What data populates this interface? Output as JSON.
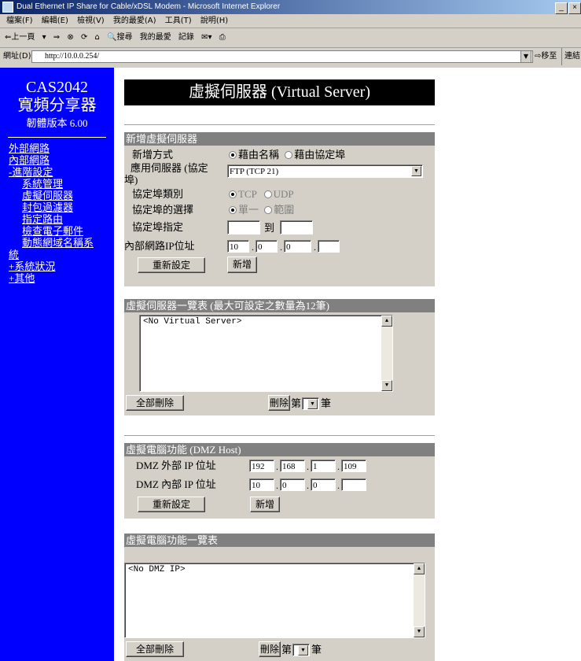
{
  "window": {
    "title": "Dual Ethernet IP Share for Cable/xDSL Modem - Microsoft Internet Explorer",
    "minimize": "_",
    "close": "×"
  },
  "menubar": [
    "檔案(F)",
    "編輯(E)",
    "檢視(V)",
    "我的最愛(A)",
    "工具(T)",
    "說明(H)"
  ],
  "toolbar": {
    "back": "⇐上一頁",
    "back_drop": "▾",
    "forward": "⇒",
    "stop": "⊗",
    "refresh": "⟳",
    "home": "⌂",
    "search": "🔍搜尋",
    "favorites": "我的最愛",
    "history": "記錄",
    "mail": "✉▾",
    "print": "⎙"
  },
  "address": {
    "label": "網址(D)",
    "url": "http://10.0.0.254/",
    "go": "⇨移至",
    "links": "連結"
  },
  "sidebar": {
    "logo_line1": "CAS2042",
    "logo_line2": "寬頻分享器",
    "firmware": "韌體版本 6.00",
    "items": [
      {
        "label": "外部網路"
      },
      {
        "label": "內部網路"
      },
      {
        "label": "-進階設定"
      },
      {
        "label": "系統管理"
      },
      {
        "label": "虛擬伺服器"
      },
      {
        "label": "封包過濾器"
      },
      {
        "label": "指定路由"
      },
      {
        "label": "檢查電子郵件"
      },
      {
        "label": "動態網域名稱系"
      },
      {
        "label": "統"
      },
      {
        "label": "+系統狀況"
      },
      {
        "label": "+其他"
      }
    ]
  },
  "page_title": "虛擬伺服器 (Virtual Server)",
  "add_vs": {
    "header": "新增虛擬伺服器",
    "method_label": "新增方式",
    "method_opt1": "藉由名稱",
    "method_opt2": "藉由協定埠",
    "app_label_1": "應用伺服器 (協定",
    "app_label_2": "埠)",
    "app_value": "FTP (TCP 21)",
    "proto_label": "協定埠類別",
    "proto_tcp": "TCP",
    "proto_udp": "UDP",
    "portsel_label": "協定埠的選擇",
    "portsel_single": "單一",
    "portsel_range": "範圍",
    "portspec_label": "協定埠指定",
    "port_to": "到",
    "ip_label": "內部網路IP位址",
    "ip": [
      "10",
      "0",
      "0",
      ""
    ],
    "reset": "重新設定",
    "add": "新增"
  },
  "vs_list": {
    "header": "虛擬伺服器一覽表 (最大可設定之數量為12筆)",
    "content": "<No Virtual Server>",
    "delete_all": "全部刪除",
    "delete": "刪除",
    "nth_prefix": "第",
    "nth_suffix": "筆"
  },
  "dmz": {
    "header": "虛擬電腦功能 (DMZ Host)",
    "ext_label": "DMZ 外部 IP 位址",
    "ext_ip": [
      "192",
      "168",
      "1",
      "109"
    ],
    "int_label": "DMZ 內部 IP 位址",
    "int_ip": [
      "10",
      "0",
      "0",
      ""
    ],
    "reset": "重新設定",
    "add": "新增"
  },
  "dmz_list": {
    "header": "虛擬電腦功能一覽表",
    "content": "<No DMZ IP>",
    "delete_all": "全部刪除",
    "delete": "刪除",
    "nth_prefix": "第",
    "nth_suffix": "筆"
  }
}
